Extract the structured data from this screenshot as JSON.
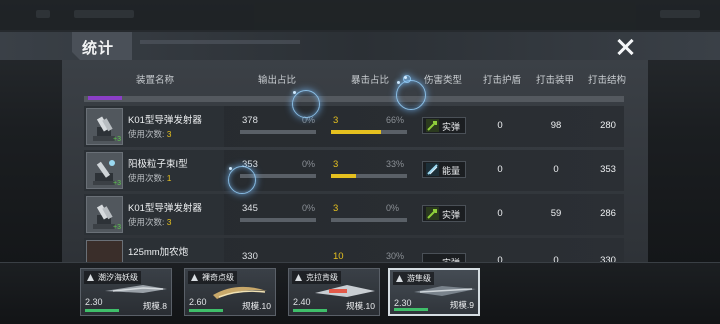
{
  "header": {
    "title": "统计",
    "close_icon": "close-icon"
  },
  "columns": [
    "装置名称",
    "输出占比",
    "暴击占比",
    "伤害类型",
    "打击护盾",
    "打击装甲",
    "打击结构"
  ],
  "rows": [
    {
      "name": "K01型导弹发射器",
      "uses_label": "使用次数:",
      "uses": "3",
      "output": "378",
      "output_pct": "0%",
      "output_fill": 0,
      "crit": "3",
      "crit_pct": "66%",
      "crit_fill": 0.66,
      "type": "实弹",
      "type_icon": "ballistic-icon",
      "shield": "0",
      "armor": "98",
      "structure": "280"
    },
    {
      "name": "阳极粒子束I型",
      "uses_label": "使用次数:",
      "uses": "1",
      "output": "353",
      "output_pct": "0%",
      "output_fill": 0,
      "crit": "3",
      "crit_pct": "33%",
      "crit_fill": 0.33,
      "type": "能量",
      "type_icon": "energy-icon",
      "shield": "0",
      "armor": "0",
      "structure": "353"
    },
    {
      "name": "K01型导弹发射器",
      "uses_label": "使用次数:",
      "uses": "3",
      "output": "345",
      "output_pct": "0%",
      "output_fill": 0,
      "crit": "3",
      "crit_pct": "0%",
      "crit_fill": 0,
      "type": "实弹",
      "type_icon": "ballistic-icon",
      "shield": "0",
      "armor": "59",
      "structure": "286"
    },
    {
      "name": "125mm加农炮",
      "output": "330",
      "crit": "10",
      "crit_pct": "30%",
      "type": "实弹",
      "shield": "0",
      "armor": "0",
      "structure": "330"
    }
  ],
  "ships": [
    {
      "name": "潮汐海妖级",
      "cost": "2.30",
      "scale": "规模.8",
      "selected": false
    },
    {
      "name": "裸奇点级",
      "cost": "2.60",
      "scale": "规模.10",
      "selected": false
    },
    {
      "name": "克拉肯级",
      "cost": "2.40",
      "scale": "规模.10",
      "selected": false
    },
    {
      "name": "游隼级",
      "cost": "2.30",
      "scale": "规模.9",
      "selected": true
    }
  ],
  "colors": {
    "accent": "#e5c01f",
    "panel": "#3b4046",
    "ballistic": "#8fcf3a",
    "energy": "#9ad8f0"
  }
}
